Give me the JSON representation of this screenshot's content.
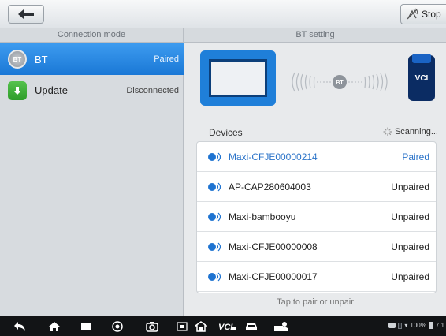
{
  "toolbar": {
    "stop_label": "Stop"
  },
  "headers": {
    "left": "Connection mode",
    "right": "BT setting"
  },
  "connection_modes": [
    {
      "label": "BT",
      "status": "Paired",
      "icon": "bluetooth-icon",
      "selected": true
    },
    {
      "label": "Update",
      "status": "Disconnected",
      "icon": "update-icon",
      "selected": false
    }
  ],
  "illustration": {
    "vci_label": "VCI",
    "signal_label": "BT"
  },
  "devices": {
    "title": "Devices",
    "scanning": "Scanning...",
    "items": [
      {
        "name": "Maxi-CFJE00000214",
        "status": "Paired"
      },
      {
        "name": "AP-CAP280604003",
        "status": "Unpaired"
      },
      {
        "name": "Maxi-bambooyu",
        "status": "Unpaired"
      },
      {
        "name": "Maxi-CFJE00000008",
        "status": "Unpaired"
      },
      {
        "name": "Maxi-CFJE00000017",
        "status": "Unpaired"
      }
    ],
    "hint": "Tap to pair or unpair"
  },
  "status_bar": {
    "battery": "100%",
    "time": "7:1"
  },
  "colors": {
    "accent": "#1e73d1",
    "selected_bg": "#2a88e3",
    "nav_bg": "#121416"
  }
}
